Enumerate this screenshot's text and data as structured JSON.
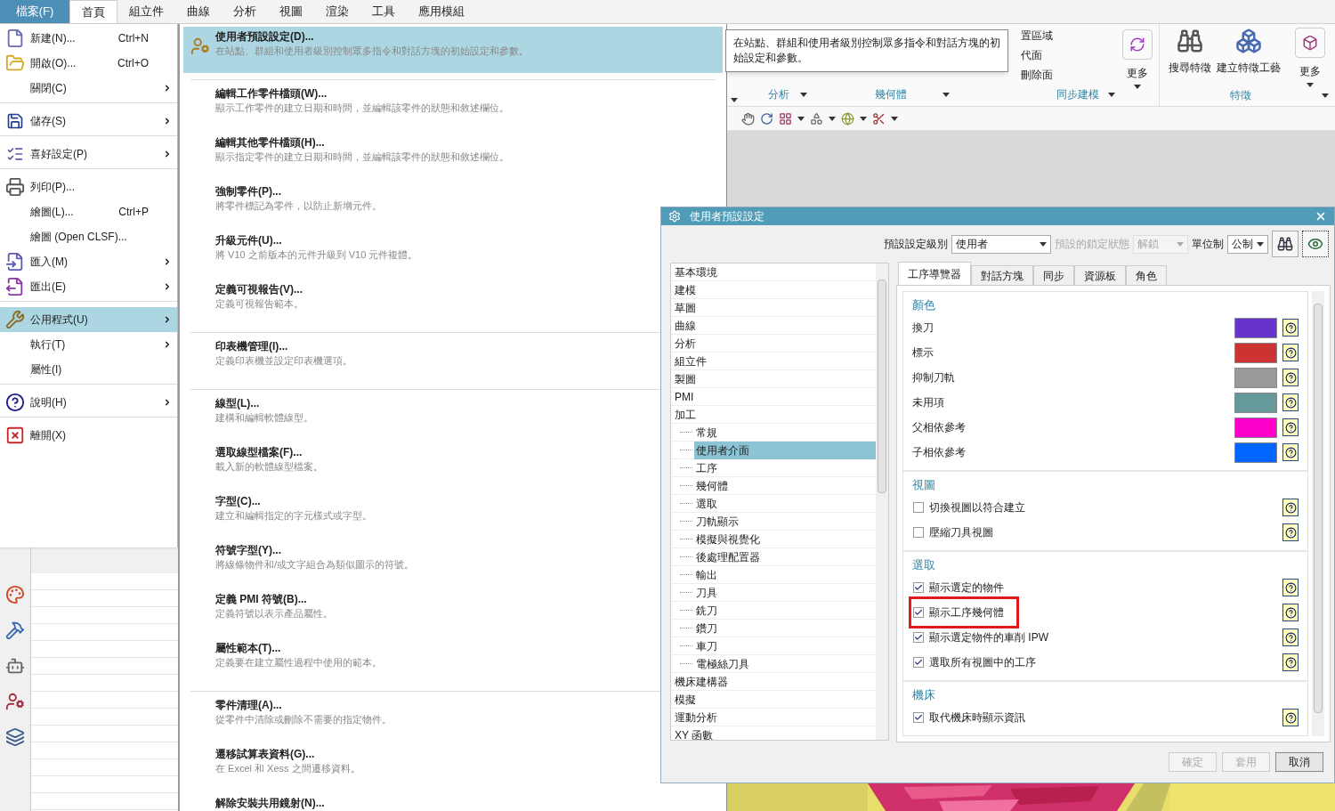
{
  "menu_bar": {
    "file_button": "檔案(F)",
    "tabs": [
      {
        "label": "首頁",
        "selected": true
      },
      {
        "label": "組立件",
        "selected": false
      },
      {
        "label": "曲線",
        "selected": false
      },
      {
        "label": "分析",
        "selected": false
      },
      {
        "label": "視圖",
        "selected": false
      },
      {
        "label": "渲染",
        "selected": false
      },
      {
        "label": "工具",
        "selected": false
      },
      {
        "label": "應用模組",
        "selected": false
      }
    ]
  },
  "ribbon": {
    "partial_items": [
      "置區域",
      "代面",
      "刪除面"
    ],
    "buttons": [
      {
        "label": "更多"
      },
      {
        "label": "搜尋特徵"
      },
      {
        "label": "建立特徵工藝"
      },
      {
        "label": "更多"
      }
    ],
    "group_labels": [
      "分析",
      "幾何體",
      "同步建模",
      "特徵"
    ]
  },
  "tooltip": {
    "text": "在站點、群組和使用者級別控制眾多指令和對話方塊的初始設定和參數。"
  },
  "file_menu": {
    "groups": [
      [
        {
          "label": "新建(N)...",
          "shortcut": "Ctrl+N",
          "has_submenu": false,
          "selected": false
        },
        {
          "label": "開啟(O)...",
          "shortcut": "Ctrl+O",
          "has_submenu": false,
          "selected": false
        },
        {
          "label": "關閉(C)",
          "has_submenu": true,
          "selected": false
        }
      ],
      [
        {
          "label": "儲存(S)",
          "has_submenu": true,
          "selected": false
        }
      ],
      [
        {
          "label": "喜好設定(P)",
          "has_submenu": true,
          "selected": false
        }
      ],
      [
        {
          "label": "列印(P)...",
          "has_submenu": false,
          "selected": false
        },
        {
          "label": "繪圖(L)...",
          "shortcut": "Ctrl+P",
          "has_submenu": false,
          "selected": false
        },
        {
          "label": "繪圖 (Open CLSF)...",
          "has_submenu": false,
          "selected": false
        },
        {
          "label": "匯入(M)",
          "has_submenu": true,
          "selected": false
        },
        {
          "label": "匯出(E)",
          "has_submenu": true,
          "selected": false
        }
      ],
      [
        {
          "label": "公用程式(U)",
          "has_submenu": true,
          "selected": true
        },
        {
          "label": "執行(T)",
          "has_submenu": true,
          "selected": false
        },
        {
          "label": "屬性(I)",
          "has_submenu": false,
          "selected": false
        }
      ],
      [
        {
          "label": "說明(H)",
          "has_submenu": true,
          "selected": false
        }
      ],
      [
        {
          "label": "離開(X)",
          "has_submenu": false,
          "selected": false
        }
      ]
    ]
  },
  "submenu": {
    "groups": [
      [
        {
          "title": "使用者預設設定(D)...",
          "description": "在站點、群組和使用者級別控制眾多指令和對話方塊的初始設定和參數。",
          "selected": true
        }
      ],
      [
        {
          "title": "編輯工作零件檔頭(W)...",
          "description": "顯示工作零件的建立日期和時間，並編輯該零件的狀態和敘述欄位。",
          "selected": false
        },
        {
          "title": "編輯其他零件檔頭(H)...",
          "description": "顯示指定零件的建立日期和時間，並編輯該零件的狀態和敘述欄位。",
          "selected": false
        },
        {
          "title": "強制零件(P)...",
          "description": "將零件標記為零件，以防止新增元件。",
          "selected": false
        },
        {
          "title": "升級元件(U)...",
          "description": "將 V10 之前版本的元件升級到 V10 元件複體。",
          "selected": false
        },
        {
          "title": "定義可視報告(V)...",
          "description": "定義可視報告範本。",
          "selected": false
        }
      ],
      [
        {
          "title": "印表機管理(I)...",
          "description": "定義印表機並設定印表機選項。",
          "selected": false
        }
      ],
      [
        {
          "title": "線型(L)...",
          "description": "建構和編輯軟體線型。",
          "selected": false
        },
        {
          "title": "選取線型檔案(F)...",
          "description": "載入新的軟體線型檔案。",
          "selected": false
        },
        {
          "title": "字型(C)...",
          "description": "建立和編輯指定的字元樣式或字型。",
          "selected": false
        },
        {
          "title": "符號字型(Y)...",
          "description": "將線條物件和/或文字組合為類似圖示的符號。",
          "selected": false
        },
        {
          "title": "定義 PMI 符號(B)...",
          "description": "定義符號以表示產品屬性。",
          "selected": false
        },
        {
          "title": "屬性範本(T)...",
          "description": "定義要在建立屬性過程中使用的範本。",
          "selected": false
        }
      ],
      [
        {
          "title": "零件清理(A)...",
          "description": "從零件中清除或刪除不需要的指定物件。",
          "selected": false
        },
        {
          "title": "遷移試算表資料(G)...",
          "description": "在 Excel 和 Xess 之間遷移資料。",
          "selected": false
        },
        {
          "title": "解除安裝共用鏡射(N)...",
          "selected": false
        }
      ]
    ]
  },
  "dialog": {
    "title": "使用者預設設定",
    "level_label": "預設設定級別",
    "level_value": "使用者",
    "lock_label": "預設的鎖定狀態",
    "lock_value": "解鎖",
    "lock_disabled": true,
    "units_label": "單位制",
    "units_value": "公制",
    "tree": [
      {
        "label": "基本環境",
        "selected": false
      },
      {
        "label": "建模",
        "selected": false
      },
      {
        "label": "草圖",
        "selected": false
      },
      {
        "label": "曲線",
        "selected": false
      },
      {
        "label": "分析",
        "selected": false
      },
      {
        "label": "組立件",
        "selected": false
      },
      {
        "label": "製圖",
        "selected": false
      },
      {
        "label": "PMI",
        "selected": false
      },
      {
        "label": "加工",
        "selected": false,
        "children": [
          {
            "label": "常規",
            "selected": false
          },
          {
            "label": "使用者介面",
            "selected": true
          },
          {
            "label": "工序",
            "selected": false
          },
          {
            "label": "幾何體",
            "selected": false
          },
          {
            "label": "選取",
            "selected": false
          },
          {
            "label": "刀軌顯示",
            "selected": false
          },
          {
            "label": "模擬與視覺化",
            "selected": false
          },
          {
            "label": "後處理配置器",
            "selected": false
          },
          {
            "label": "輸出",
            "selected": false
          },
          {
            "label": "刀具",
            "selected": false
          },
          {
            "label": "銑刀",
            "selected": false
          },
          {
            "label": "鑽刀",
            "selected": false
          },
          {
            "label": "車刀",
            "selected": false
          },
          {
            "label": "電極絲刀具",
            "selected": false
          }
        ]
      },
      {
        "label": "機床建構器",
        "selected": false
      },
      {
        "label": "模擬",
        "selected": false
      },
      {
        "label": "運動分析",
        "selected": false
      },
      {
        "label": "XY 函數",
        "selected": false
      }
    ],
    "tabs": [
      {
        "label": "工序導覽器",
        "selected": true
      },
      {
        "label": "對話方塊",
        "selected": false
      },
      {
        "label": "同步",
        "selected": false
      },
      {
        "label": "資源板",
        "selected": false
      },
      {
        "label": "角色",
        "selected": false
      }
    ],
    "sections": [
      {
        "title": "顏色",
        "rows": [
          {
            "kind": "color",
            "label": "換刀",
            "color": "#6633cc"
          },
          {
            "kind": "color",
            "label": "標示",
            "color": "#cc3333"
          },
          {
            "kind": "color",
            "label": "抑制刀軌",
            "color": "#999999"
          },
          {
            "kind": "color",
            "label": "未用項",
            "color": "#669999"
          },
          {
            "kind": "color",
            "label": "父相依參考",
            "color": "#ff00cc"
          },
          {
            "kind": "color",
            "label": "子相依參考",
            "color": "#0066ff"
          }
        ]
      },
      {
        "title": "視圖",
        "rows": [
          {
            "kind": "check",
            "label": "切換視圖以符合建立",
            "checked": false,
            "highlighted": false
          },
          {
            "kind": "check",
            "label": "壓縮刀具視圖",
            "checked": false,
            "highlighted": false
          }
        ]
      },
      {
        "title": "選取",
        "rows": [
          {
            "kind": "check",
            "label": "顯示選定的物件",
            "checked": true,
            "highlighted": false
          },
          {
            "kind": "check",
            "label": "顯示工序幾何體",
            "checked": true,
            "highlighted": true
          },
          {
            "kind": "check",
            "label": "顯示選定物件的車削 IPW",
            "checked": true,
            "highlighted": false
          },
          {
            "kind": "check",
            "label": "選取所有視圖中的工序",
            "checked": true,
            "highlighted": false
          }
        ]
      },
      {
        "title": "機床",
        "rows": [
          {
            "kind": "check",
            "label": "取代機床時顯示資訊",
            "checked": true,
            "highlighted": false
          }
        ]
      }
    ],
    "buttons": [
      {
        "label": "確定",
        "disabled": true
      },
      {
        "label": "套用",
        "disabled": true
      },
      {
        "label": "取消",
        "disabled": false
      }
    ]
  }
}
